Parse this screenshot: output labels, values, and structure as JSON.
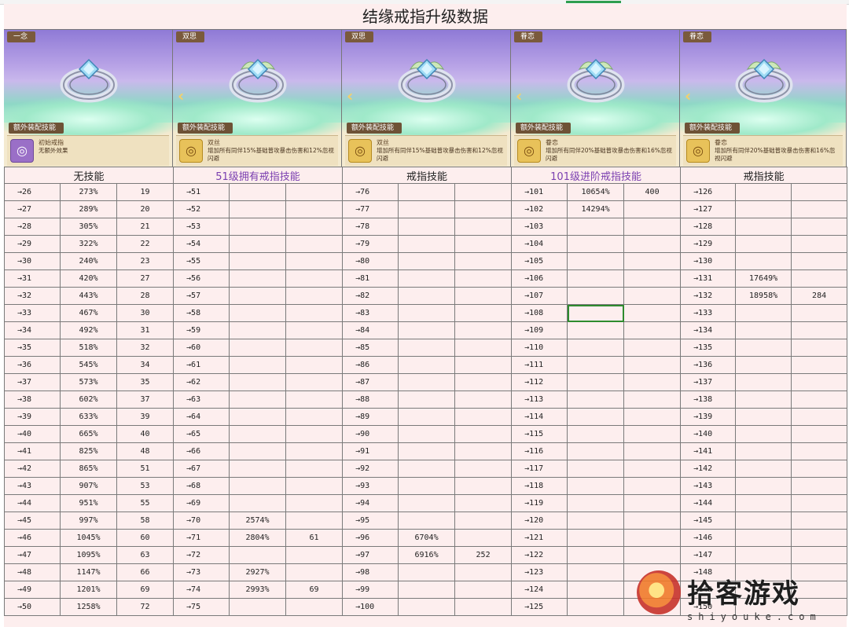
{
  "title": "结缘戒指升级数据",
  "cards": [
    {
      "tag": "一念",
      "skill_header": "额外装配技能",
      "skill_name": "初始戒指",
      "skill_desc": "无额外效果",
      "icon": "ring-icon",
      "has_arrow": false
    },
    {
      "tag": "双思",
      "skill_header": "额外装配技能",
      "skill_name": "双丝",
      "skill_desc": "增加所有同伴15%基础普攻暴击伤害和12%忽视闪避",
      "icon": "ring-icon",
      "has_arrow": true
    },
    {
      "tag": "双思",
      "skill_header": "额外装配技能",
      "skill_name": "双丝",
      "skill_desc": "增加所有同伴15%基础普攻暴击伤害和12%忽视闪避",
      "icon": "ring-icon",
      "has_arrow": true
    },
    {
      "tag": "眷恋",
      "skill_header": "额外装配技能",
      "skill_name": "眷恋",
      "skill_desc": "增加所有同伴20%基础普攻暴击伤害和16%忽视闪避",
      "icon": "ring-icon",
      "has_arrow": true
    },
    {
      "tag": "眷恋",
      "skill_header": "额外装配技能",
      "skill_name": "眷恋",
      "skill_desc": "增加所有同伴20%基础普攻暴击伤害和16%忽视闪避",
      "icon": "ring-icon",
      "has_arrow": true
    }
  ],
  "sections": [
    "无技能",
    "51级拥有戒指技能",
    "戒指技能",
    "101级进阶戒指技能",
    "戒指技能"
  ],
  "section_colors": [
    "#222222",
    "#7b3fb0",
    "#222222",
    "#7b3fb0",
    "#222222"
  ],
  "rows": [
    [
      [
        "→26",
        "273%",
        "19"
      ],
      [
        "→51",
        "",
        ""
      ],
      [
        "→76",
        "",
        ""
      ],
      [
        "→101",
        "10654%",
        "400"
      ],
      [
        "→126",
        "",
        ""
      ]
    ],
    [
      [
        "→27",
        "289%",
        "20"
      ],
      [
        "→52",
        "",
        ""
      ],
      [
        "→77",
        "",
        ""
      ],
      [
        "→102",
        "14294%",
        ""
      ],
      [
        "→127",
        "",
        ""
      ]
    ],
    [
      [
        "→28",
        "305%",
        "21"
      ],
      [
        "→53",
        "",
        ""
      ],
      [
        "→78",
        "",
        ""
      ],
      [
        "→103",
        "",
        ""
      ],
      [
        "→128",
        "",
        ""
      ]
    ],
    [
      [
        "→29",
        "322%",
        "22"
      ],
      [
        "→54",
        "",
        ""
      ],
      [
        "→79",
        "",
        ""
      ],
      [
        "→104",
        "",
        ""
      ],
      [
        "→129",
        "",
        ""
      ]
    ],
    [
      [
        "→30",
        "240%",
        "23"
      ],
      [
        "→55",
        "",
        ""
      ],
      [
        "→80",
        "",
        ""
      ],
      [
        "→105",
        "",
        ""
      ],
      [
        "→130",
        "",
        ""
      ]
    ],
    [
      [
        "→31",
        "420%",
        "27"
      ],
      [
        "→56",
        "",
        ""
      ],
      [
        "→81",
        "",
        ""
      ],
      [
        "→106",
        "",
        ""
      ],
      [
        "→131",
        "17649%",
        ""
      ]
    ],
    [
      [
        "→32",
        "443%",
        "28"
      ],
      [
        "→57",
        "",
        ""
      ],
      [
        "→82",
        "",
        ""
      ],
      [
        "→107",
        "",
        ""
      ],
      [
        "→132",
        "18958%",
        "284"
      ]
    ],
    [
      [
        "→33",
        "467%",
        "30"
      ],
      [
        "→58",
        "",
        ""
      ],
      [
        "→83",
        "",
        ""
      ],
      [
        "→108",
        "",
        ""
      ],
      [
        "→133",
        "",
        ""
      ]
    ],
    [
      [
        "→34",
        "492%",
        "31"
      ],
      [
        "→59",
        "",
        ""
      ],
      [
        "→84",
        "",
        ""
      ],
      [
        "→109",
        "",
        ""
      ],
      [
        "→134",
        "",
        ""
      ]
    ],
    [
      [
        "→35",
        "518%",
        "32"
      ],
      [
        "→60",
        "",
        ""
      ],
      [
        "→85",
        "",
        ""
      ],
      [
        "→110",
        "",
        ""
      ],
      [
        "→135",
        "",
        ""
      ]
    ],
    [
      [
        "→36",
        "545%",
        "34"
      ],
      [
        "→61",
        "",
        ""
      ],
      [
        "→86",
        "",
        ""
      ],
      [
        "→111",
        "",
        ""
      ],
      [
        "→136",
        "",
        ""
      ]
    ],
    [
      [
        "→37",
        "573%",
        "35"
      ],
      [
        "→62",
        "",
        ""
      ],
      [
        "→87",
        "",
        ""
      ],
      [
        "→112",
        "",
        ""
      ],
      [
        "→137",
        "",
        ""
      ]
    ],
    [
      [
        "→38",
        "602%",
        "37"
      ],
      [
        "→63",
        "",
        ""
      ],
      [
        "→88",
        "",
        ""
      ],
      [
        "→113",
        "",
        ""
      ],
      [
        "→138",
        "",
        ""
      ]
    ],
    [
      [
        "→39",
        "633%",
        "39"
      ],
      [
        "→64",
        "",
        ""
      ],
      [
        "→89",
        "",
        ""
      ],
      [
        "→114",
        "",
        ""
      ],
      [
        "→139",
        "",
        ""
      ]
    ],
    [
      [
        "→40",
        "665%",
        "40"
      ],
      [
        "→65",
        "",
        ""
      ],
      [
        "→90",
        "",
        ""
      ],
      [
        "→115",
        "",
        ""
      ],
      [
        "→140",
        "",
        ""
      ]
    ],
    [
      [
        "→41",
        "825%",
        "48"
      ],
      [
        "→66",
        "",
        ""
      ],
      [
        "→91",
        "",
        ""
      ],
      [
        "→116",
        "",
        ""
      ],
      [
        "→141",
        "",
        ""
      ]
    ],
    [
      [
        "→42",
        "865%",
        "51"
      ],
      [
        "→67",
        "",
        ""
      ],
      [
        "→92",
        "",
        ""
      ],
      [
        "→117",
        "",
        ""
      ],
      [
        "→142",
        "",
        ""
      ]
    ],
    [
      [
        "→43",
        "907%",
        "53"
      ],
      [
        "→68",
        "",
        ""
      ],
      [
        "→93",
        "",
        ""
      ],
      [
        "→118",
        "",
        ""
      ],
      [
        "→143",
        "",
        ""
      ]
    ],
    [
      [
        "→44",
        "951%",
        "55"
      ],
      [
        "→69",
        "",
        ""
      ],
      [
        "→94",
        "",
        ""
      ],
      [
        "→119",
        "",
        ""
      ],
      [
        "→144",
        "",
        ""
      ]
    ],
    [
      [
        "→45",
        "997%",
        "58"
      ],
      [
        "→70",
        "2574%",
        ""
      ],
      [
        "→95",
        "",
        ""
      ],
      [
        "→120",
        "",
        ""
      ],
      [
        "→145",
        "",
        ""
      ]
    ],
    [
      [
        "→46",
        "1045%",
        "60"
      ],
      [
        "→71",
        "2804%",
        "61"
      ],
      [
        "→96",
        "6704%",
        ""
      ],
      [
        "→121",
        "",
        ""
      ],
      [
        "→146",
        "",
        ""
      ]
    ],
    [
      [
        "→47",
        "1095%",
        "63"
      ],
      [
        "→72",
        "",
        ""
      ],
      [
        "→97",
        "6916%",
        "252"
      ],
      [
        "→122",
        "",
        ""
      ],
      [
        "→147",
        "",
        ""
      ]
    ],
    [
      [
        "→48",
        "1147%",
        "66"
      ],
      [
        "→73",
        "2927%",
        ""
      ],
      [
        "→98",
        "",
        ""
      ],
      [
        "→123",
        "",
        ""
      ],
      [
        "→148",
        "",
        ""
      ]
    ],
    [
      [
        "→49",
        "1201%",
        "69"
      ],
      [
        "→74",
        "2993%",
        "69"
      ],
      [
        "→99",
        "",
        ""
      ],
      [
        "→124",
        "",
        ""
      ],
      [
        "→149",
        "",
        ""
      ]
    ],
    [
      [
        "→50",
        "1258%",
        "72"
      ],
      [
        "→75",
        "",
        ""
      ],
      [
        "→100",
        "",
        ""
      ],
      [
        "→125",
        "",
        ""
      ],
      [
        "→150",
        "",
        ""
      ]
    ]
  ],
  "active_cell": {
    "row": 7,
    "group": 3,
    "col": 1
  },
  "watermark": {
    "text": "拾客游戏",
    "url": "shiyouke.com"
  }
}
